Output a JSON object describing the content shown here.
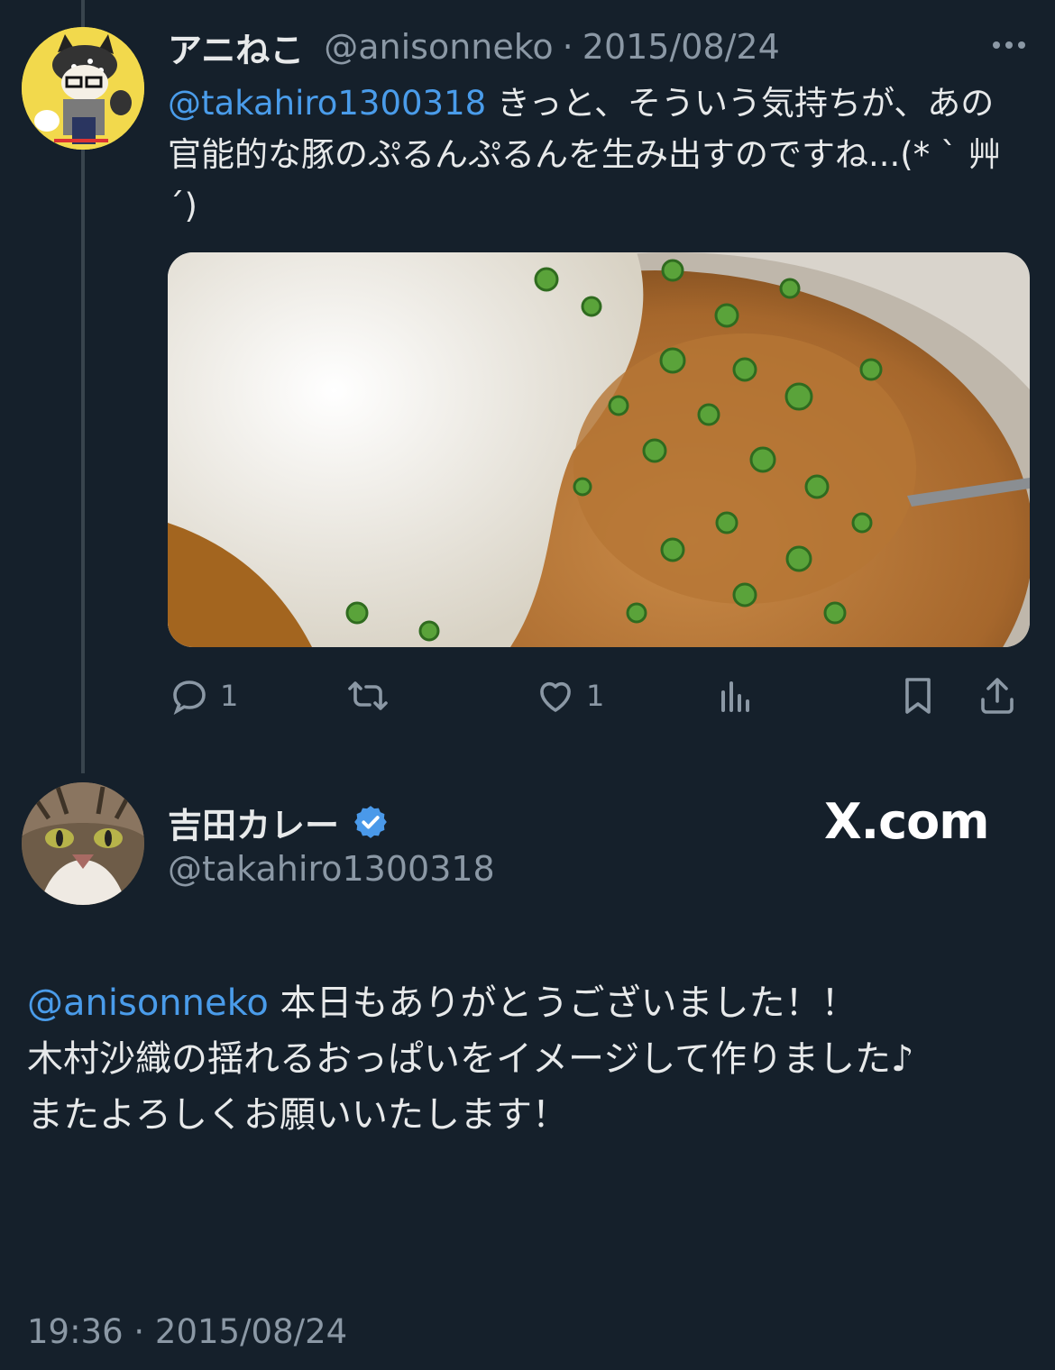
{
  "reply_tweet": {
    "display_name": "アニねこ",
    "handle": "@anisonneko",
    "separator": "·",
    "date": "2015/08/24",
    "mention": "@takahiro1300318",
    "text_after_mention": " きっと、そういう気持ちが、あの官能的な豚のぷるんぷるんを生み出すのですね...(* ` 艸´)",
    "image_alt": "curry-rice-photo",
    "reply_count": "1",
    "like_count": "1",
    "icons": {
      "more": "more-icon",
      "reply": "reply-icon",
      "retweet": "retweet-icon",
      "like": "heart-icon",
      "views": "analytics-icon",
      "bookmark": "bookmark-icon",
      "share": "share-icon"
    }
  },
  "main_tweet": {
    "display_name": "吉田カレー",
    "handle": "@takahiro1300318",
    "verified": true,
    "mention": "@anisonneko",
    "line1_rest": " 本日もありがとうございました！！",
    "line2": "木村沙織の揺れるおっぱいをイメージして作りました♪",
    "line3": "またよろしくお願いいたします！",
    "timestamp": "19:36 · 2015/08/24"
  },
  "watermark": "X.com",
  "colors": {
    "background": "#15202b",
    "text": "#e7e9ea",
    "muted": "#8b98a5",
    "link": "#4a9cea",
    "verified": "#4a99e9",
    "thread_line": "#38444d"
  }
}
